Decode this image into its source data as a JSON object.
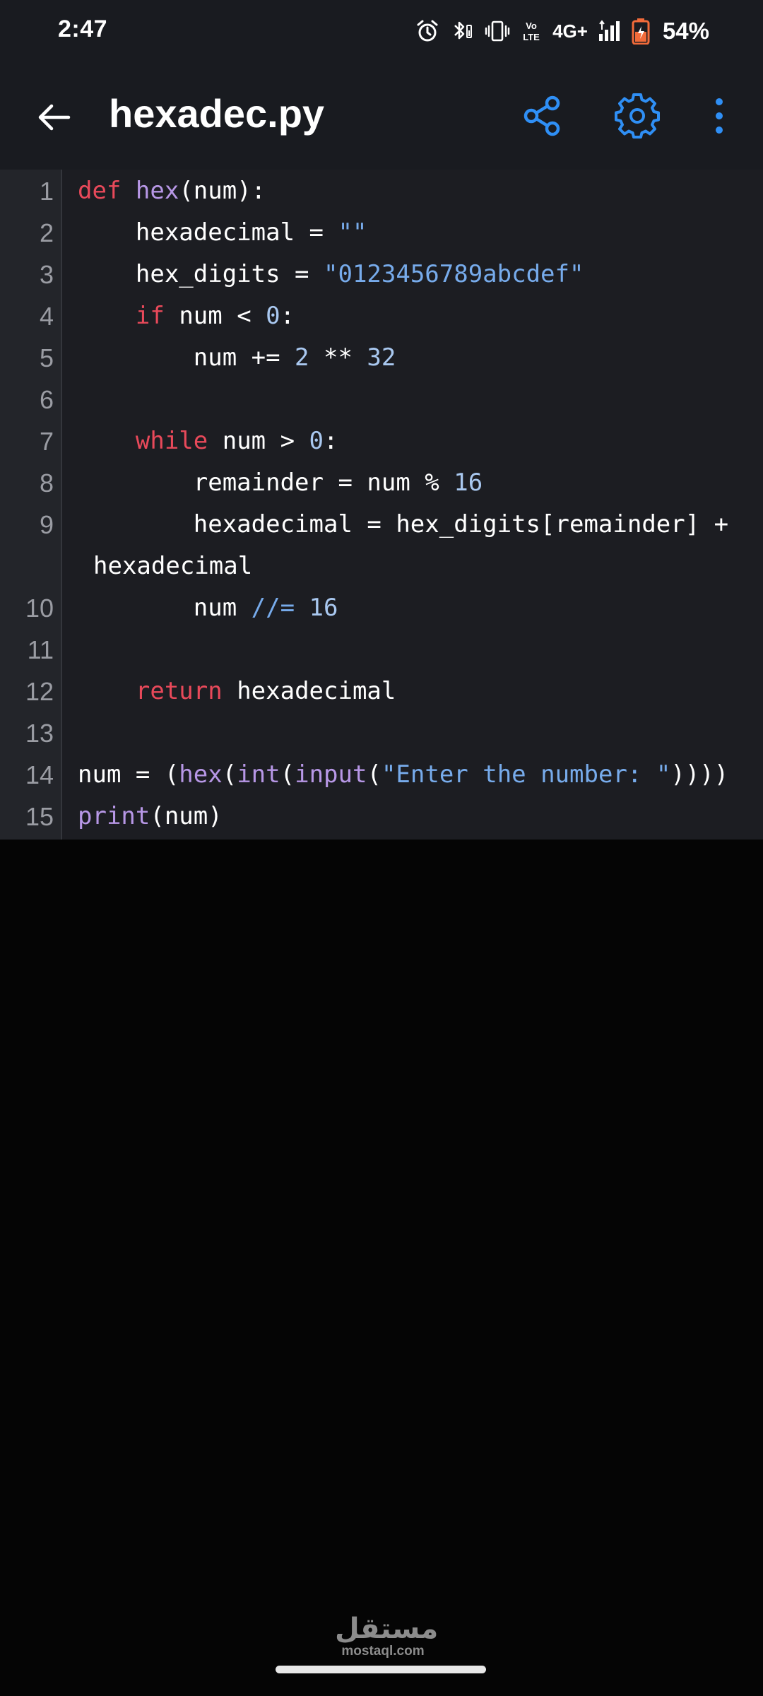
{
  "status_bar": {
    "time": "2:47",
    "network_label": "4G+",
    "volte_label": "VoLTE",
    "battery_percent": "54%",
    "battery_level": 0.54,
    "icons": [
      "alarm-icon",
      "bluetooth-icon",
      "vibrate-icon",
      "volte-icon",
      "signal-icon",
      "battery-icon"
    ]
  },
  "app_bar": {
    "title": "hexadec.py",
    "back_icon": "arrow-left-icon",
    "share_icon": "share-icon",
    "settings_icon": "gear-icon",
    "more_icon": "more-vertical-icon",
    "accent_color": "#2f8ff5"
  },
  "editor": {
    "colors": {
      "keyword": "#e8495a",
      "function": "#b797e6",
      "string": "#77abeb",
      "number": "#a9c8f0",
      "text": "#ffffff",
      "line_number": "#9a9ca3"
    },
    "lines": [
      {
        "n": "1",
        "text": "def hex(num):"
      },
      {
        "n": "2",
        "text": "    hexadecimal = \"\""
      },
      {
        "n": "3",
        "text": "    hex_digits = \"0123456789abcdef\""
      },
      {
        "n": "4",
        "text": "    if num < 0:"
      },
      {
        "n": "5",
        "text": "        num += 2 ** 32"
      },
      {
        "n": "6",
        "text": ""
      },
      {
        "n": "7",
        "text": "    while num > 0:"
      },
      {
        "n": "8",
        "text": "        remainder = num % 16"
      },
      {
        "n": "9",
        "text": "        hexadecimal = hex_digits[remainder] +"
      },
      {
        "n": "",
        "text": "hexadecimal",
        "wrapped": true
      },
      {
        "n": "10",
        "text": "        num //= 16"
      },
      {
        "n": "11",
        "text": ""
      },
      {
        "n": "12",
        "text": "    return hexadecimal"
      },
      {
        "n": "13",
        "text": ""
      },
      {
        "n": "14",
        "text": "num = (hex(int(input(\"Enter the number: \"))))"
      },
      {
        "n": "15",
        "text": "print(num)"
      }
    ]
  },
  "watermark": {
    "logo_text": "مستقل",
    "url": "mostaql.com"
  }
}
